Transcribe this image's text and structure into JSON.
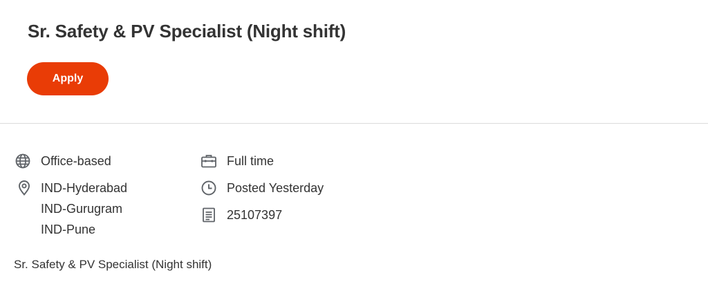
{
  "job": {
    "title": "Sr. Safety & PV Specialist (Night shift)",
    "apply_label": "Apply",
    "work_type": "Office-based",
    "locations": [
      "IND-Hyderabad",
      "IND-Gurugram",
      "IND-Pune"
    ],
    "employment_type": "Full time",
    "posted": "Posted Yesterday",
    "requisition_id": "25107397",
    "description_title": "Sr. Safety & PV Specialist (Night shift)"
  },
  "icons": {
    "work_type": "globe-icon",
    "location": "location-pin-icon",
    "employment_type": "briefcase-icon",
    "posted": "clock-icon",
    "requisition_id": "document-icon"
  },
  "colors": {
    "accent": "#e93c06",
    "text": "#333333",
    "icon": "#5f6368",
    "divider": "#dcdcdc"
  }
}
